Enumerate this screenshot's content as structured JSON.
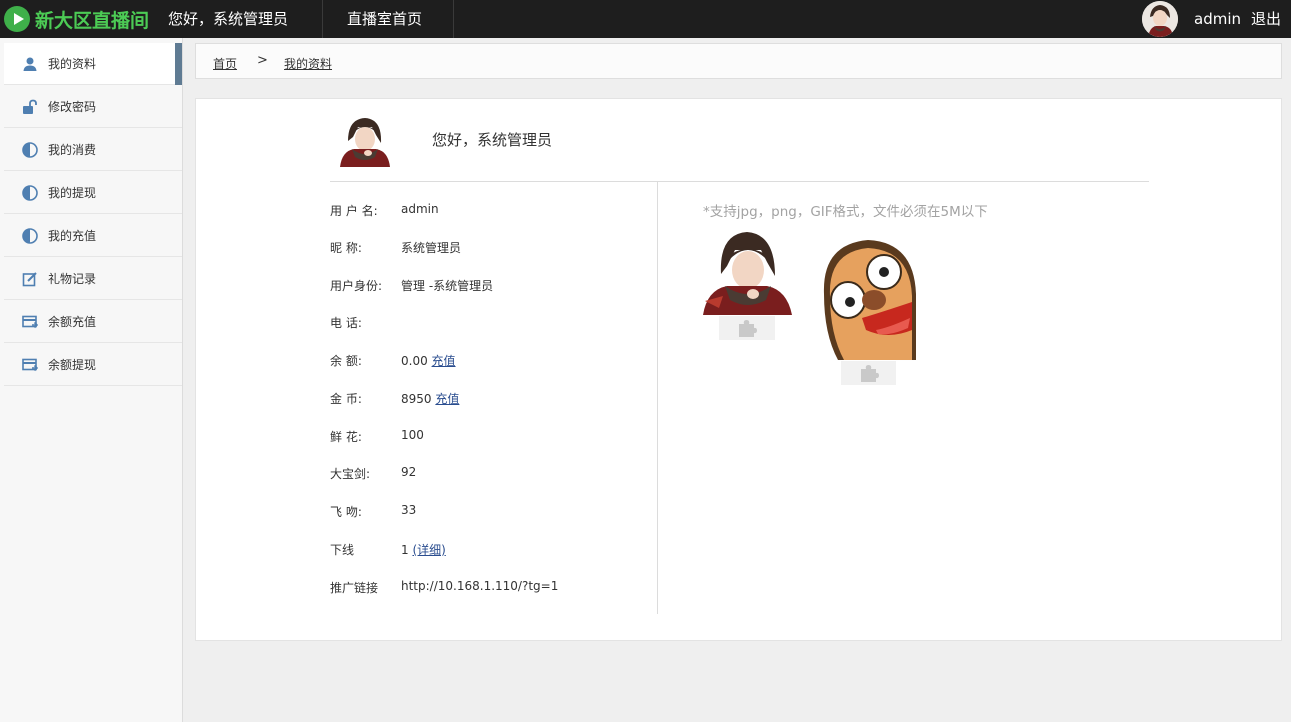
{
  "header": {
    "logo_text": "新大区直播间",
    "greeting": "您好，系统管理员",
    "nav_home": "直播室首页",
    "username": "admin",
    "logout": "退出"
  },
  "sidebar": {
    "items": [
      {
        "label": "我的资料",
        "icon": "user-icon",
        "active": true
      },
      {
        "label": "修改密码",
        "icon": "lock-icon"
      },
      {
        "label": "我的消费",
        "icon": "pie-icon"
      },
      {
        "label": "我的提现",
        "icon": "pie-icon"
      },
      {
        "label": "我的充值",
        "icon": "pie-icon"
      },
      {
        "label": "礼物记录",
        "icon": "edit-icon"
      },
      {
        "label": "余额充值",
        "icon": "card-icon"
      },
      {
        "label": "余额提现",
        "icon": "card-icon"
      }
    ]
  },
  "breadcrumb": {
    "home": "首页",
    "separator": ">",
    "current": "我的资料"
  },
  "profile": {
    "greeting": "您好，系统管理员",
    "fields": [
      {
        "label": "用 户 名:",
        "value": "admin"
      },
      {
        "label": "昵  称:",
        "value": "系统管理员"
      },
      {
        "label": "用户身份:",
        "value": "管理 -系统管理员"
      },
      {
        "label": "电  话:",
        "value": ""
      },
      {
        "label": "余  额:",
        "value": "0.00",
        "link": "充值"
      },
      {
        "label": "金  币:",
        "value": "8950",
        "link": "充值"
      },
      {
        "label": "鲜  花:",
        "value": "100"
      },
      {
        "label": "大宝剑:",
        "value": "92"
      },
      {
        "label": "飞  吻:",
        "value": "33"
      },
      {
        "label": "下线",
        "value": "1",
        "link": "(详细)"
      },
      {
        "label": "推广链接",
        "value": "http://10.168.1.110/?tg=1"
      }
    ]
  },
  "upload": {
    "hint": "*支持jpg，png，GIF格式，文件必须在5M以下"
  },
  "colors": {
    "topbar": "#1e1e1e",
    "brand_green": "#4ccb55",
    "sidebar_active_marker": "#5f7b93",
    "link": "#2a4d8f"
  }
}
